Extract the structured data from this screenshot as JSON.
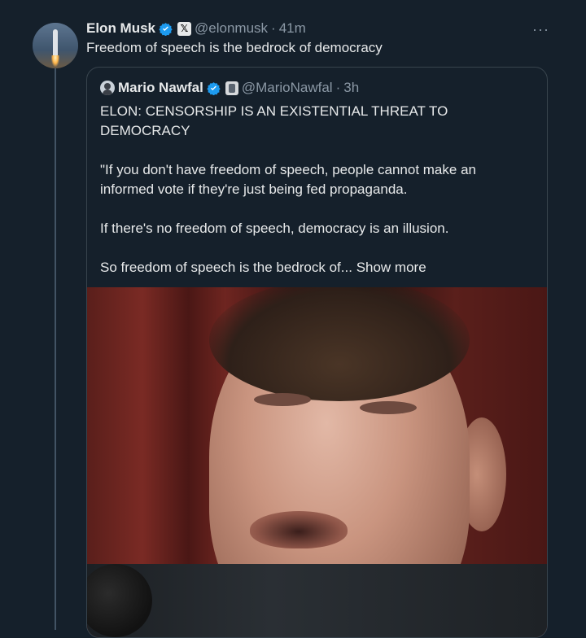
{
  "tweet": {
    "author_name": "Elon Musk",
    "handle": "@elonmusk",
    "separator": "·",
    "time": "41m",
    "text": "Freedom of speech is the bedrock of democracy",
    "more_icon": "···"
  },
  "quoted": {
    "author_name": "Mario Nawfal",
    "handle": "@MarioNawfal",
    "separator": "·",
    "time": "3h",
    "paragraphs": [
      "ELON: CENSORSHIP IS AN EXISTENTIAL THREAT TO DEMOCRACY",
      "\"If you don't have freedom of speech, people cannot make an informed vote if they're just being fed propaganda.",
      "If there's no freedom of speech, democracy is an illusion."
    ],
    "last_line": "So freedom of speech is the bedrock of...",
    "show_more": "Show more"
  },
  "colors": {
    "background": "#15202b",
    "verified_blue": "#1d9bf0",
    "secondary_text": "#8b98a5"
  }
}
